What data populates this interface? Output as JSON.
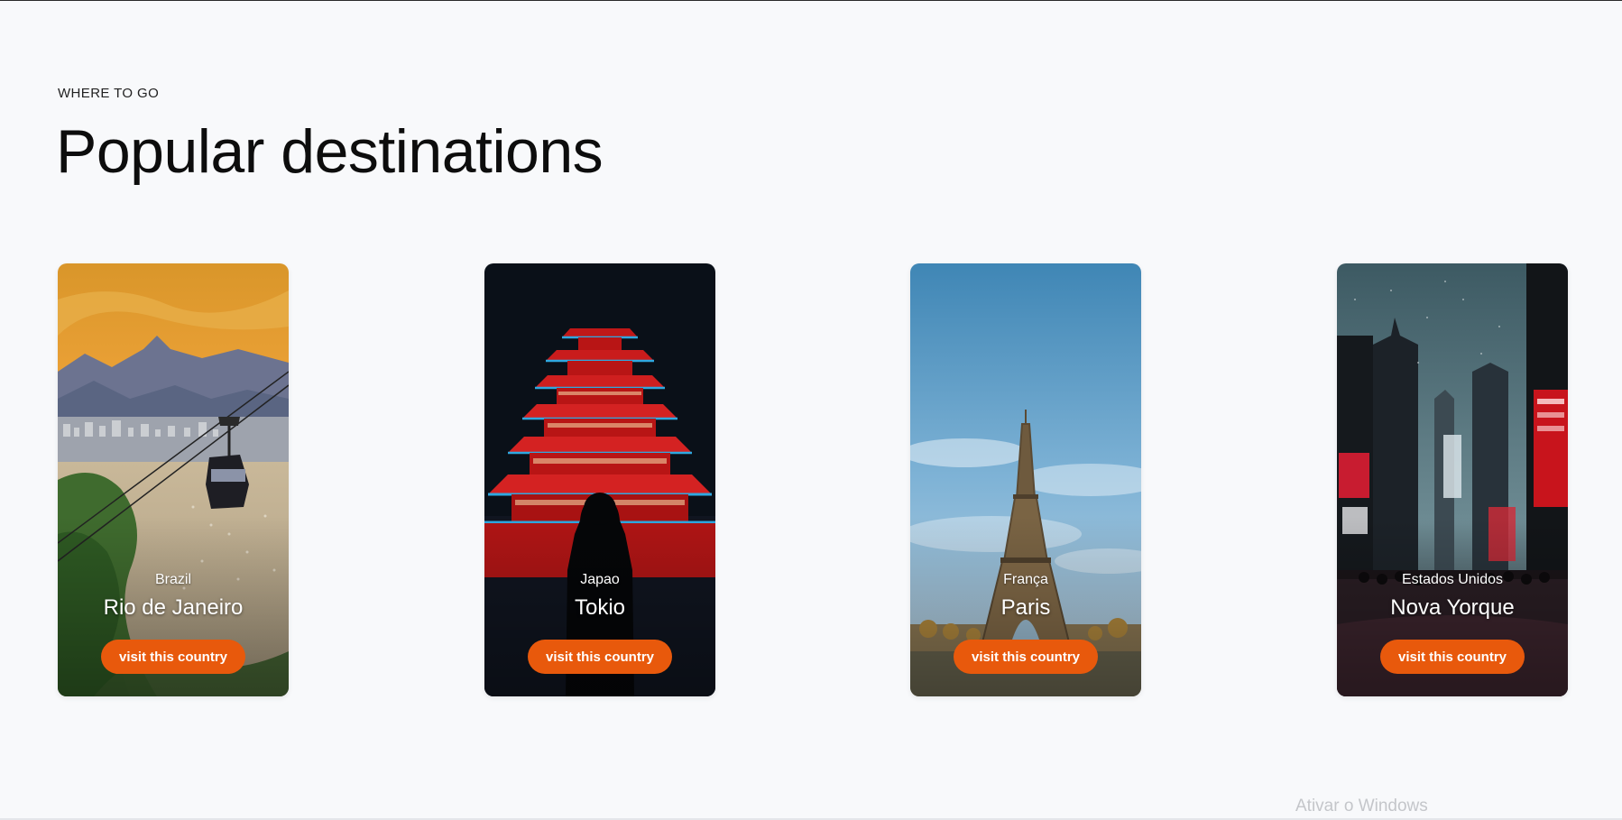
{
  "section": {
    "eyebrow": "WHERE TO GO",
    "title": "Popular destinations"
  },
  "destinations": [
    {
      "country": "Brazil",
      "city": "Rio de Janeiro",
      "button_label": "visit this country",
      "image": "rio-cable-car-photo"
    },
    {
      "country": "Japao",
      "city": "Tokio",
      "button_label": "visit this country",
      "image": "tokyo-pagoda-night-photo"
    },
    {
      "country": "França",
      "city": "Paris",
      "button_label": "visit this country",
      "image": "paris-eiffel-tower-photo"
    },
    {
      "country": "Estados Unidos",
      "city": "Nova Yorque",
      "button_label": "visit this country",
      "image": "new-york-times-square-photo"
    }
  ],
  "colors": {
    "accent": "#e8590c",
    "background": "#f8f9fb"
  },
  "os_watermark": "Ativar o Windows"
}
